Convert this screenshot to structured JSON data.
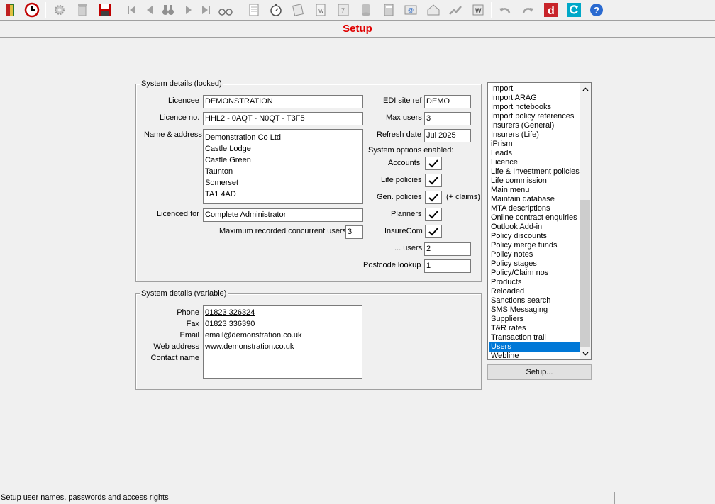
{
  "window": {
    "title": "Setup"
  },
  "toolbar": {
    "icons": [
      "exit-door-icon",
      "clock-arrow-icon",
      "settings-gear-icon",
      "delete-bin-icon",
      "save-disk-icon",
      "first-record-icon",
      "previous-record-icon",
      "find-binoculars-icon",
      "next-record-icon",
      "last-record-icon",
      "spectacles-icon",
      "notepad-icon",
      "stopwatch-icon",
      "scroll-icon",
      "word-doc-icon",
      "diary-icon",
      "database-icon",
      "calculator-icon",
      "email-icon",
      "home-icon",
      "chart-arrow-icon",
      "word-export-icon",
      "undo-icon",
      "redo-icon",
      "d-logo-icon",
      "refresh-icon",
      "help-icon"
    ]
  },
  "locked": {
    "title": "System details (locked)",
    "licencee_label": "Licencee",
    "licencee": "DEMONSTRATION",
    "licence_no_label": "Licence no.",
    "licence_no": "HHL2 - 0AQT - N0QT - T3F5",
    "name_address_label": "Name & address",
    "address": [
      "Demonstration Co Ltd",
      "Castle Lodge",
      "Castle Green",
      "Taunton",
      "Somerset",
      "TA1 4AD"
    ],
    "licenced_for_label": "Licenced for",
    "licenced_for": "Complete Administrator",
    "max_concurrent_label": "Maximum recorded concurrent users",
    "max_concurrent": "3",
    "edi_label": "EDI site ref",
    "edi": "DEMO",
    "max_users_label": "Max users",
    "max_users": "3",
    "refresh_label": "Refresh date",
    "refresh": "Jul 2025",
    "options_label": "System options enabled:",
    "options": [
      {
        "label": "Accounts",
        "checked": true
      },
      {
        "label": "Life policies",
        "checked": true
      },
      {
        "label": "Gen. policies",
        "checked": true,
        "note": "(+ claims)"
      },
      {
        "label": "Planners",
        "checked": true
      },
      {
        "label": "InsureCom",
        "checked": true
      }
    ],
    "users_label": "... users",
    "users": "2",
    "postcode_label": "Postcode lookup",
    "postcode": "1"
  },
  "variable": {
    "title": "System details (variable)",
    "labels": [
      "Phone",
      "Fax",
      "Email",
      "Web address",
      "Contact name"
    ],
    "values": [
      "01823 326324",
      "01823 336390",
      "email@demonstration.co.uk",
      "www.demonstration.co.uk",
      ""
    ]
  },
  "list": {
    "items": [
      "Import",
      "Import ARAG",
      "Import notebooks",
      "Import policy references",
      "Insurers (General)",
      "Insurers (Life)",
      "iPrism",
      "Leads",
      "Licence",
      "Life & Investment policies",
      "Life commission",
      "Main menu",
      "Maintain database",
      "MTA descriptions",
      "Online contract enquiries",
      "Outlook Add-in",
      "Policy discounts",
      "Policy merge funds",
      "Policy notes",
      "Policy stages",
      "Policy/Claim nos",
      "Products",
      "Reloaded",
      "Sanctions search",
      "SMS Messaging",
      "Suppliers",
      "T&R rates",
      "Transaction trail",
      "Users",
      "Webline"
    ],
    "selected": "Users"
  },
  "setup_button": "Setup...",
  "status": {
    "text": "Setup user names, passwords and access rights"
  }
}
